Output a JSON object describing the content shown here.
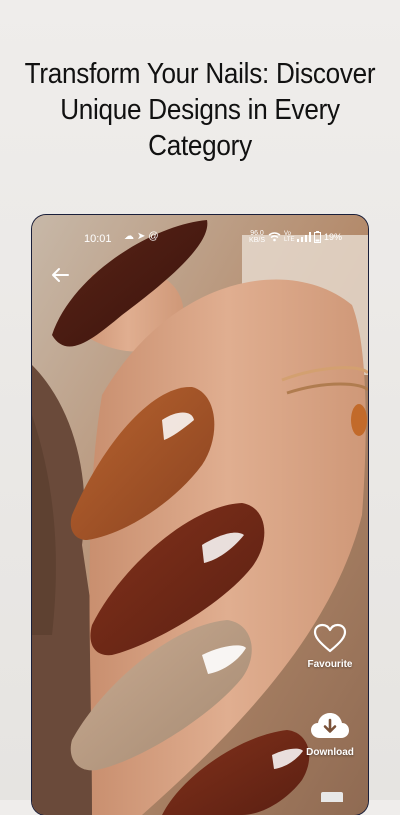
{
  "headline": {
    "line1": "Transform Your Nails: Discover",
    "line2": "Unique Designs in Every",
    "line3": "Category"
  },
  "statusbar": {
    "time": "10:01",
    "net_speed_value": "96.0",
    "net_speed_unit": "KB/S",
    "network_label": "Vo LTE",
    "battery": "19%"
  },
  "actions": {
    "favourite_label": "Favourite",
    "download_label": "Download"
  },
  "icons": {
    "back": "back-arrow-icon",
    "favourite": "heart-icon",
    "download": "cloud-download-icon"
  },
  "colors": {
    "nail_dark": "#4a1c12",
    "nail_caramel": "#9c4e26",
    "nail_chestnut": "#6b2616",
    "nail_beige": "#b89a82",
    "skin": "#d8a283"
  }
}
